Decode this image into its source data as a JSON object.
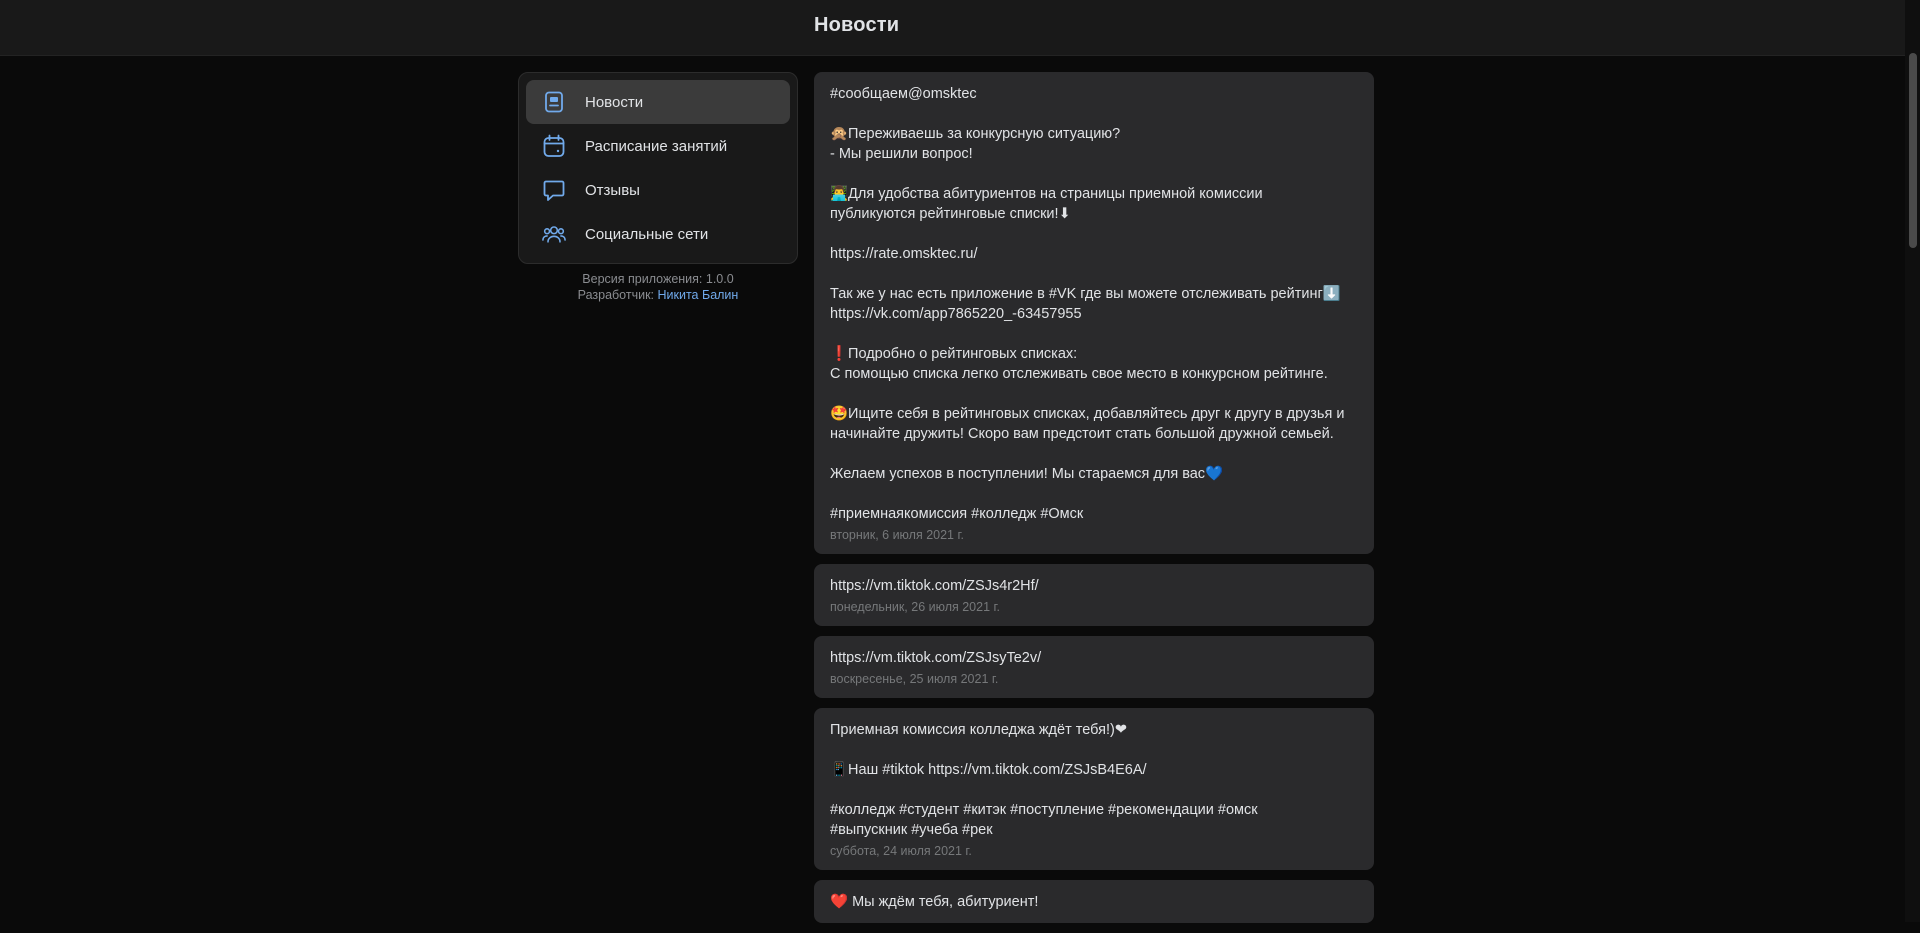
{
  "header": {
    "title": "Новости"
  },
  "sidebar": {
    "items": [
      {
        "label": "Новости",
        "icon": "news-icon",
        "active": true
      },
      {
        "label": "Расписание занятий",
        "icon": "calendar-icon",
        "active": false
      },
      {
        "label": "Отзывы",
        "icon": "chat-bubble-icon",
        "active": false
      },
      {
        "label": "Социальные сети",
        "icon": "users-icon",
        "active": false
      }
    ],
    "version_text": "Версия приложения: 1.0.0",
    "developer_prefix": "Разработчик:",
    "developer_name": "Никита Балин"
  },
  "colors": {
    "accent": "#71aaeb",
    "background": "#0a0a0a",
    "card": "#2a2a2c",
    "heart": "#e64646"
  },
  "posts": [
    {
      "lines": [
        "#сообщаем@omsktec",
        "",
        "🙊Переживаешь за конкурсную ситуацию?",
        "- Мы решили вопрос!",
        "",
        "👨‍💻Для удобства абитуриентов на страницы приемной комиссии",
        "публикуются рейтинговые списки!⬇",
        "",
        "https://rate.omsktec.ru/",
        "",
        "Так же у нас есть приложение в #VK где вы можете отслеживать рейтинг⬇️",
        "https://vk.com/app7865220_-63457955",
        "",
        "❗Подробно о рейтинговых списках:",
        "С помощью списка легко отслеживать свое место в конкурсном рейтинге.",
        "",
        "🤩Ищите себя в рейтинговых списках, добавляйтесь друг к другу в друзья и",
        "начинайте дружить! Скоро вам предстоит стать большой дружной семьей.",
        "",
        "Желаем успехов в поступлении! Мы стараемся для вас💙",
        "",
        "#приемнаякомиссия #колледж #Омск"
      ],
      "date": "вторник, 6 июля 2021 г."
    },
    {
      "lines": [
        "https://vm.tiktok.com/ZSJs4r2Hf/"
      ],
      "date": "понедельник, 26 июля 2021 г."
    },
    {
      "lines": [
        "https://vm.tiktok.com/ZSJsyTe2v/"
      ],
      "date": "воскресенье, 25 июля 2021 г."
    },
    {
      "lines": [
        "Приемная комиссия колледжа ждёт тебя!)❤",
        "",
        "📱Наш #tiktok https://vm.tiktok.com/ZSJsB4E6A/",
        "",
        "#колледж #студент #китэк #поступление #рекомендации #омск",
        "#выпускник #учеба #рек"
      ],
      "date": "суббота, 24 июля 2021 г."
    },
    {
      "lines": [
        "❤️ Мы ждём тебя, абитуриент!"
      ],
      "date": ""
    }
  ]
}
